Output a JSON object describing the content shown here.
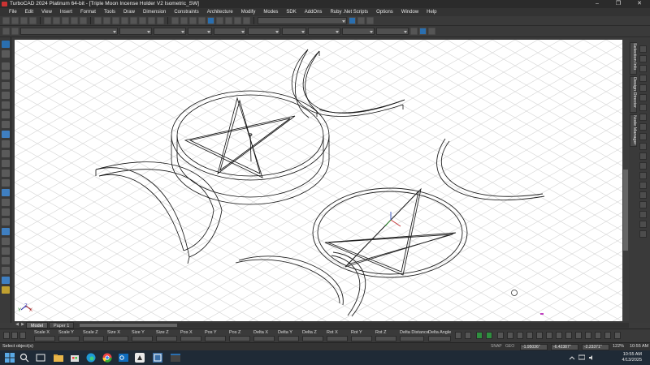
{
  "window": {
    "title": "TurboCAD 2024 Platinum 64-bit - [Triple Moon Incense Holder V2 Isometric_SW]",
    "controls": {
      "minimize": "–",
      "restore": "❐",
      "close": "✕"
    }
  },
  "menu": {
    "items": [
      "File",
      "Edit",
      "View",
      "Insert",
      "Format",
      "Tools",
      "Draw",
      "Dimension",
      "Constraints",
      "Architecture",
      "Modify",
      "Modes",
      "SDK",
      "AddOns",
      "Ruby .Net Scripts",
      "Options",
      "Window",
      "Help"
    ]
  },
  "side_tabs": {
    "selection_info": "Selection Info",
    "design_director": "Design Director",
    "node_manager": "Node Manager"
  },
  "canvas": {
    "axis_labels": {
      "y": "Y",
      "x": "X",
      "z": "Z"
    }
  },
  "space_tabs": {
    "model": "Model",
    "paper": "Paper 1"
  },
  "inspector": {
    "fields": [
      "Scale X",
      "Scale Y",
      "Scale Z",
      "Size X",
      "Size Y",
      "Size Z",
      "Pos X",
      "Pos Y",
      "Pos Z",
      "Delta X",
      "Delta Y",
      "Delta Z",
      "Rot X",
      "Rot Y",
      "Rot Z",
      "Delta Distance",
      "Delta Angle"
    ]
  },
  "status": {
    "message": "Select object(s)",
    "snap": "SNAP",
    "geo": "GEO",
    "x": "-1.95036\"",
    "y": "-6.42387\"",
    "z": "-2.23371\"",
    "zoom": "122%"
  },
  "taskbar": {
    "time": "10:55 AM",
    "date": "4/13/2025",
    "clock_time": "10:55 AM"
  },
  "colors": {
    "accent": "#2a6fb0",
    "canvas_bg": "#ffffff",
    "ui_bg": "#3a3a3a",
    "grid": "#d6d6d6"
  }
}
